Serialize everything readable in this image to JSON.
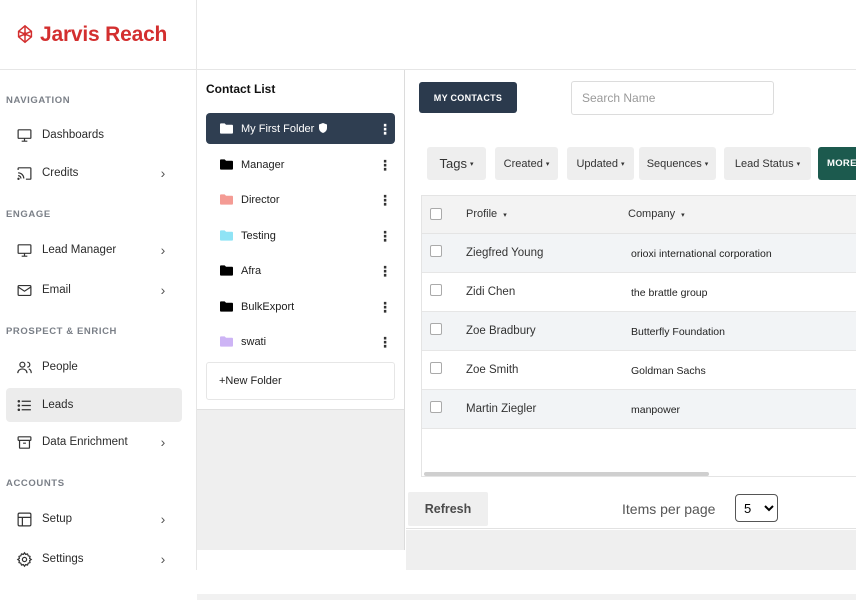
{
  "brand": {
    "name": "Jarvis Reach",
    "color": "#d32f2f"
  },
  "sidebar": {
    "sections": [
      {
        "label": "NAVIGATION"
      },
      {
        "label": "ENGAGE"
      },
      {
        "label": "PROSPECT & ENRICH"
      },
      {
        "label": "ACCOUNTS"
      }
    ],
    "items": [
      {
        "label": "Dashboards",
        "icon": "monitor-icon"
      },
      {
        "label": "Credits",
        "icon": "cast-icon",
        "chevron": "›"
      },
      {
        "label": "Lead Manager",
        "icon": "monitor-icon",
        "chevron": "›"
      },
      {
        "label": "Email",
        "icon": "mail-icon",
        "chevron": "›"
      },
      {
        "label": "People",
        "icon": "users-icon"
      },
      {
        "label": "Leads",
        "icon": "list-icon",
        "active": true
      },
      {
        "label": "Data Enrichment",
        "icon": "archive-icon",
        "chevron": "›"
      },
      {
        "label": "Setup",
        "icon": "layout-icon",
        "chevron": "›"
      },
      {
        "label": "Settings",
        "icon": "gear-icon",
        "chevron": "›"
      }
    ]
  },
  "contact_list": {
    "title": "Contact List",
    "folders": [
      {
        "name": "My First Folder",
        "color": "#ffffff",
        "active": true
      },
      {
        "name": "Manager",
        "color": "#000000"
      },
      {
        "name": "Director",
        "color": "#f49b94"
      },
      {
        "name": "Testing",
        "color": "#8fe3f5"
      },
      {
        "name": "Afra",
        "color": "#000000"
      },
      {
        "name": "BulkExport",
        "color": "#000000"
      },
      {
        "name": "swati",
        "color": "#cdb4f5"
      }
    ],
    "kebab": "⋮",
    "new_folder": "+New Folder"
  },
  "main": {
    "my_contacts_label": "MY CONTACTS",
    "search_placeholder": "Search Name",
    "filters": {
      "tags": "Tags",
      "created": "Created",
      "updated": "Updated",
      "sequences": "Sequences",
      "lead_status": "Lead Status",
      "more": "MORE"
    },
    "caret": "▾",
    "table": {
      "columns": [
        "Profile",
        "Company"
      ],
      "rows": [
        {
          "profile": "Ziegfred Young",
          "company": "orioxi international corporation"
        },
        {
          "profile": "Zidi Chen",
          "company": "the brattle group"
        },
        {
          "profile": "Zoe Bradbury",
          "company": "Butterfly Foundation"
        },
        {
          "profile": "Zoe Smith",
          "company": "Goldman Sachs"
        },
        {
          "profile": "Martin Ziegler",
          "company": "manpower"
        }
      ]
    },
    "refresh_label": "Refresh",
    "items_per_page_label": "Items per page",
    "items_per_page_value": "5"
  }
}
